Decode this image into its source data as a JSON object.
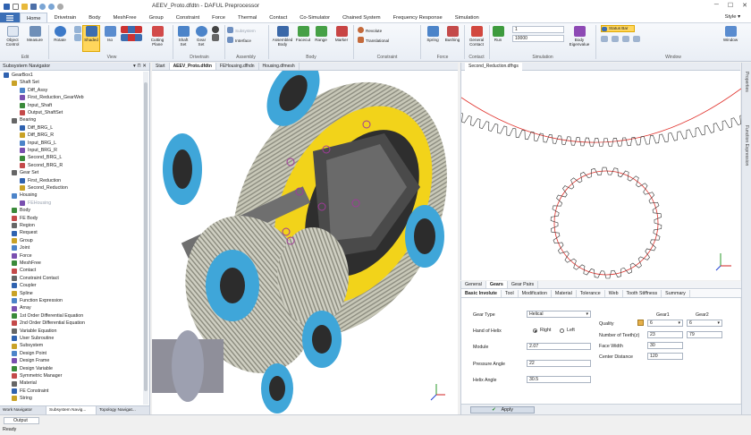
{
  "window": {
    "title": "AEEV_Proto.dfdtn - DAFUL Preprocessor",
    "style_label": "Style ▾"
  },
  "menubar": {
    "file_label": "",
    "tabs": [
      "Home",
      "Drivetrain",
      "Body",
      "MeshFree",
      "Group",
      "Constraint",
      "Force",
      "Thermal",
      "Contact",
      "Co-Simulator",
      "Chained System",
      "Frequency Response",
      "Simulation"
    ]
  },
  "ribbon": {
    "buttons": {
      "object_control": "Object Control",
      "measure": "Measure",
      "rotate": "Rotate",
      "shaded": "Shaded",
      "iso": "Iso",
      "cutting_plane": "Cutting Plane",
      "shaft_set": "Shaft Set",
      "gear_set": "Gear Set",
      "subsystem": "Subsystem",
      "interface": "Interface",
      "assembled_body": "Assembled Body",
      "facecut": "Facecut",
      "range": "Range",
      "marker": "Marker",
      "revolute": "Revolute",
      "translational": "Translational",
      "spring": "Spring",
      "bushing": "Bushing",
      "general_contact": "General Contact",
      "run": "Run",
      "body_eigenvalue": "Body Eigenvalue",
      "status_bar": "Status Bar",
      "window": "Window"
    },
    "groups": {
      "edit": "Edit",
      "view": "View",
      "drivetrain": "Drivetrain",
      "assembly": "Assembly",
      "body": "Body",
      "constraint": "Constraint",
      "force": "Force",
      "contact": "Contact",
      "simulation": "Simulation",
      "window": "Window"
    },
    "sim_inputs": {
      "end_time": "1",
      "steps": "10000"
    }
  },
  "navigator": {
    "header": "Subsystem Navigator",
    "items": [
      {
        "label": "GearBox1",
        "depth": 0
      },
      {
        "label": "Shaft Set",
        "depth": 1
      },
      {
        "label": "Diff_Assy",
        "depth": 2
      },
      {
        "label": "First_Reduction_GearWeb",
        "depth": 2
      },
      {
        "label": "Input_Shaft",
        "depth": 2
      },
      {
        "label": "Output_ShaftSet",
        "depth": 2
      },
      {
        "label": "Bearing",
        "depth": 1
      },
      {
        "label": "Diff_BRG_L",
        "depth": 2
      },
      {
        "label": "Diff_BRG_R",
        "depth": 2
      },
      {
        "label": "Input_BRG_L",
        "depth": 2
      },
      {
        "label": "Input_BRG_R",
        "depth": 2
      },
      {
        "label": "Second_BRG_L",
        "depth": 2
      },
      {
        "label": "Second_BRG_R",
        "depth": 2
      },
      {
        "label": "Gear Set",
        "depth": 1
      },
      {
        "label": "First_Reduction",
        "depth": 2
      },
      {
        "label": "Second_Reduction",
        "depth": 2
      },
      {
        "label": "Housing",
        "depth": 1
      },
      {
        "label": "FEHousing",
        "depth": 2,
        "dim": true
      },
      {
        "label": "Body",
        "depth": 1
      },
      {
        "label": "FE Body",
        "depth": 1
      },
      {
        "label": "Region",
        "depth": 1
      },
      {
        "label": "Request",
        "depth": 1
      },
      {
        "label": "Group",
        "depth": 1
      },
      {
        "label": "Joint",
        "depth": 1
      },
      {
        "label": "Force",
        "depth": 1
      },
      {
        "label": "MeshFree",
        "depth": 1
      },
      {
        "label": "Contact",
        "depth": 1
      },
      {
        "label": "Constraint Contact",
        "depth": 1
      },
      {
        "label": "Coupler",
        "depth": 1
      },
      {
        "label": "Spline",
        "depth": 1
      },
      {
        "label": "Function Expression",
        "depth": 1
      },
      {
        "label": "Array",
        "depth": 1
      },
      {
        "label": "1st Order Differential Equation",
        "depth": 1
      },
      {
        "label": "2nd Order Differential Equation",
        "depth": 1
      },
      {
        "label": "Variable Equation",
        "depth": 1
      },
      {
        "label": "User Subroutine",
        "depth": 1
      },
      {
        "label": "Subsystem",
        "depth": 1
      },
      {
        "label": "Design Point",
        "depth": 1
      },
      {
        "label": "Design Frame",
        "depth": 1
      },
      {
        "label": "Design Variable",
        "depth": 1
      },
      {
        "label": "Symmetric Manager",
        "depth": 1
      },
      {
        "label": "Material",
        "depth": 1
      },
      {
        "label": "FE Constraint",
        "depth": 1
      },
      {
        "label": "String",
        "depth": 1
      }
    ],
    "bottom_tabs": [
      "Work Navigator",
      "Subsystem Navig...",
      "Topology Navigat..."
    ]
  },
  "viewtabs": [
    "Start",
    "AEEV_Proto.dfdtn",
    "FEHousing.dfhdn",
    "Housing.dfmesh"
  ],
  "right_view": {
    "tab": "Second_Reduction.dfhgs"
  },
  "props": {
    "tabs1": [
      "General",
      "Gears",
      "Gear Pairs"
    ],
    "tabs2": [
      "Basic Involute",
      "Tool",
      "Modification",
      "Material",
      "Tolerance",
      "Web",
      "Tooth Stiffness",
      "Summary"
    ],
    "gear_type_label": "Gear Type",
    "gear_type_value": "Helical",
    "hand_label": "Hand of Helix",
    "hand_right": "Right",
    "hand_left": "Left",
    "module_label": "Module",
    "module_value": "2.07",
    "pressure_label": "Pressure Angle",
    "pressure_value": "22",
    "helix_label": "Helix Angle",
    "helix_value": "30.5",
    "gear1_hdr": "Gear1",
    "gear2_hdr": "Gear2",
    "quality_label": "Quality",
    "quality_g1": "6",
    "quality_g2": "6",
    "teeth_label": "Number of Teeth(z)",
    "teeth_g1": "23",
    "teeth_g2": "79",
    "face_label": "Face Width",
    "face_value": "30",
    "center_label": "Center Distance",
    "center_value": "120",
    "apply": "Apply"
  },
  "right_strip": {
    "properties": "Properties",
    "function_expression": "Function Expression"
  },
  "status": {
    "output_tab": "Output",
    "ready": "Ready"
  },
  "colors": {
    "accent": "#3b6fb6",
    "gear_yellow": "#f2d31a",
    "bearing_blue": "#3fa6d9",
    "profile_red": "#e0302a"
  }
}
